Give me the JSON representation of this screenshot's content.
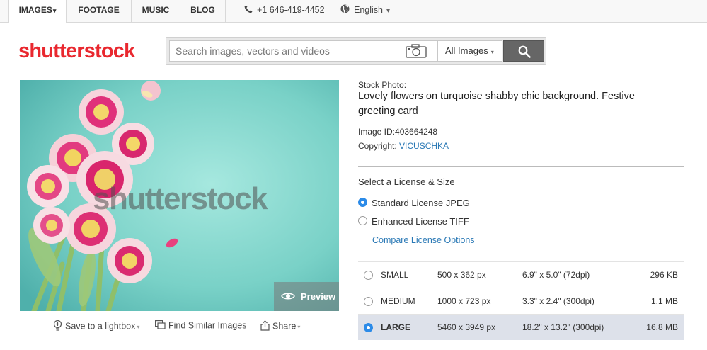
{
  "nav": {
    "tabs": [
      {
        "label": "IMAGES",
        "caret": "▾"
      },
      {
        "label": "FOOTAGE"
      },
      {
        "label": "MUSIC"
      },
      {
        "label": "BLOG"
      }
    ],
    "phone": "+1 646-419-4452",
    "language": "English",
    "language_caret": "▾"
  },
  "header": {
    "logo": "shutterstock",
    "search_placeholder": "Search images, vectors and videos",
    "search_category": "All Images",
    "search_category_caret": "▾"
  },
  "preview": {
    "watermark": "shutterstock",
    "preview_label": "Preview",
    "actions": {
      "lightbox": "Save to a lightbox",
      "similar": "Find Similar Images",
      "share": "Share"
    }
  },
  "details": {
    "stock_label": "Stock Photo:",
    "title": "Lovely flowers on turquoise shabby chic background. Festive greeting card",
    "image_id_label": "Image ID:403664248",
    "copyright_label": "Copyright:",
    "copyright_name": "VICUSCHKA"
  },
  "license": {
    "heading": "Select a License & Size",
    "options": [
      {
        "label": "Standard License JPEG",
        "selected": true
      },
      {
        "label": "Enhanced License TIFF",
        "selected": false
      }
    ],
    "compare_link": "Compare License Options"
  },
  "sizes": [
    {
      "name": "SMALL",
      "pixels": "500 x 362 px",
      "inches": "6.9\" x 5.0\" (72dpi)",
      "filesize": "296 KB",
      "selected": false
    },
    {
      "name": "MEDIUM",
      "pixels": "1000 x 723 px",
      "inches": "3.3\" x 2.4\" (300dpi)",
      "filesize": "1.1 MB",
      "selected": false
    },
    {
      "name": "LARGE",
      "pixels": "5460 x 3949 px",
      "inches": "18.2\" x 13.2\" (300dpi)",
      "filesize": "16.8 MB",
      "selected": true
    }
  ],
  "colors": {
    "brand_red": "#e9282f",
    "link_blue": "#2978b5",
    "radio_blue": "#2c8be8",
    "photo_bg": "#7ed4cb"
  }
}
